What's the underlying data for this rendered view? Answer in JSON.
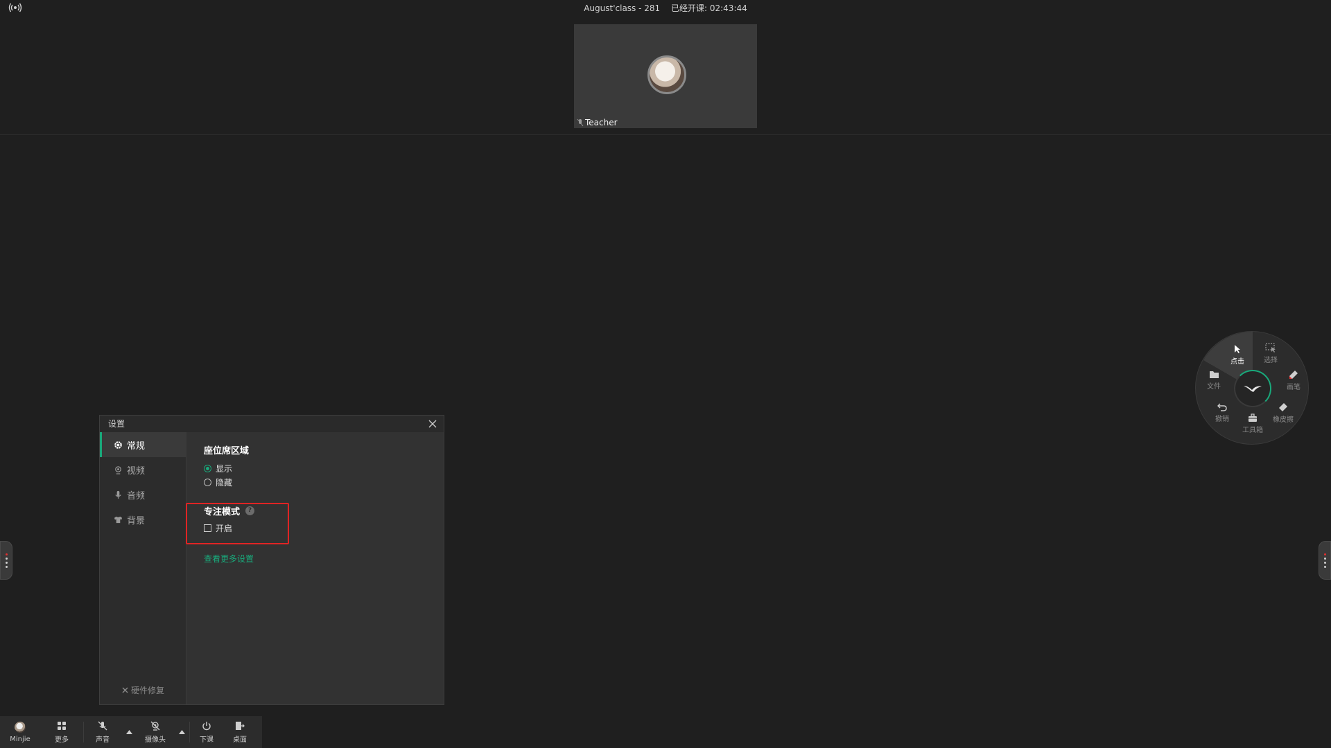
{
  "titlebar": {
    "class_name": "August'class - 281",
    "status": "已经开课: 02:43:44"
  },
  "seat": {
    "teacher_name": "Teacher"
  },
  "settings_dialog": {
    "title": "设置",
    "sidebar": [
      {
        "label": "常规",
        "icon": "gear-icon",
        "active": true
      },
      {
        "label": "视频",
        "icon": "camera-icon",
        "active": false
      },
      {
        "label": "音频",
        "icon": "mic-icon",
        "active": false
      },
      {
        "label": "背景",
        "icon": "shirt-icon",
        "active": false
      }
    ],
    "hardware_repair": "硬件修复",
    "seat_area": {
      "title": "座位席区域",
      "options": [
        "显示",
        "隐藏"
      ],
      "selected": "显示"
    },
    "focus_mode": {
      "title": "专注模式",
      "help": "?",
      "checkbox_label": "开启",
      "checked": false
    },
    "more_settings": "查看更多设置"
  },
  "radial_menu": {
    "items": {
      "click": "点击",
      "select": "选择",
      "pen": "画笔",
      "eraser": "橡皮擦",
      "toolbox": "工具箱",
      "undo": "撤销",
      "file": "文件"
    },
    "accent": "#19a97b"
  },
  "bottom_toolbar": {
    "user": "Minjie",
    "more": "更多",
    "sound": "声音",
    "camera": "摄像头",
    "end_class": "下课",
    "desktop": "桌面"
  },
  "colors": {
    "background": "#1f1f1f",
    "accent": "#19a97b",
    "highlight": "#e02424"
  }
}
